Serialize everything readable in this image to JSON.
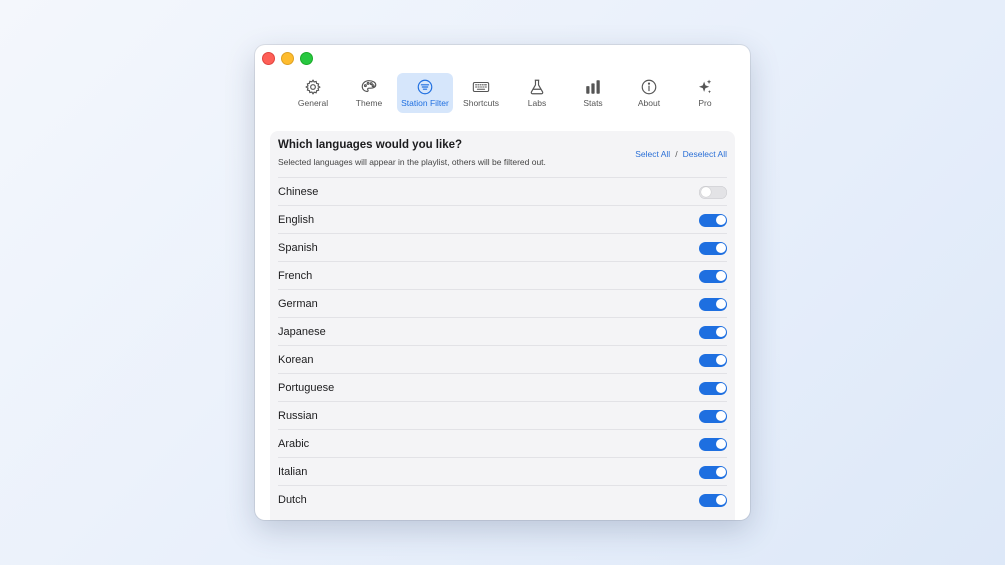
{
  "tabs": [
    {
      "label": "General",
      "icon": "gear-icon"
    },
    {
      "label": "Theme",
      "icon": "palette-icon"
    },
    {
      "label": "Station Filter",
      "icon": "filter-list-icon",
      "active": true
    },
    {
      "label": "Shortcuts",
      "icon": "keyboard-icon"
    },
    {
      "label": "Labs",
      "icon": "flask-icon"
    },
    {
      "label": "Stats",
      "icon": "bar-chart-icon"
    },
    {
      "label": "About",
      "icon": "info-icon"
    },
    {
      "label": "Pro",
      "icon": "sparkles-icon"
    }
  ],
  "panel": {
    "title": "Which languages would you like?",
    "subtitle": "Selected languages will appear in the playlist, others will be filtered out.",
    "select_all": "Select All",
    "separator": "/",
    "deselect_all": "Deselect All"
  },
  "languages": [
    {
      "name": "Chinese",
      "enabled": false
    },
    {
      "name": "English",
      "enabled": true
    },
    {
      "name": "Spanish",
      "enabled": true
    },
    {
      "name": "French",
      "enabled": true
    },
    {
      "name": "German",
      "enabled": true
    },
    {
      "name": "Japanese",
      "enabled": true
    },
    {
      "name": "Korean",
      "enabled": true
    },
    {
      "name": "Portuguese",
      "enabled": true
    },
    {
      "name": "Russian",
      "enabled": true
    },
    {
      "name": "Arabic",
      "enabled": true
    },
    {
      "name": "Italian",
      "enabled": true
    },
    {
      "name": "Dutch",
      "enabled": true
    }
  ],
  "colors": {
    "accent": "#1e6fe0",
    "active_tab_bg": "#d6e6fb"
  }
}
